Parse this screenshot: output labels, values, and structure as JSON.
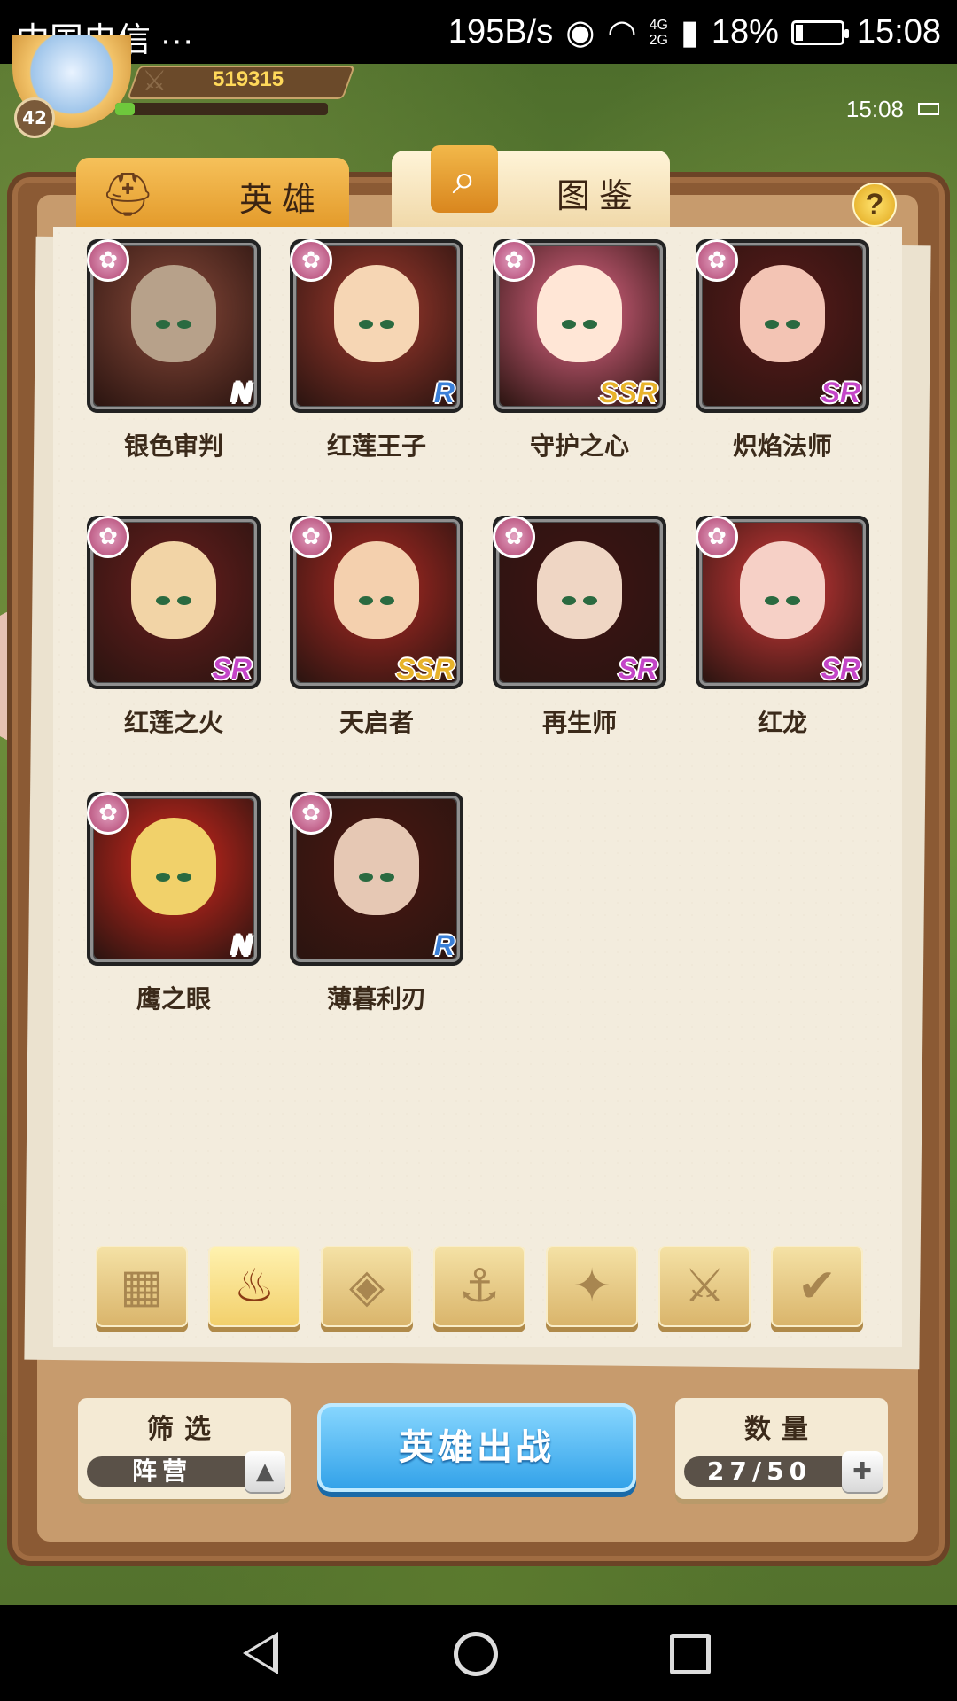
{
  "status_bar": {
    "carrier": "中国电信",
    "more": "···",
    "speed": "195B/s",
    "network_top": "4G",
    "network_bottom": "2G",
    "battery_percent": "18%",
    "time": "15:08"
  },
  "hud": {
    "player_level": "42",
    "power": "519315",
    "exp_fraction": 0.09,
    "game_time": "15:08"
  },
  "tabs": [
    {
      "label": "英雄",
      "icon": "knight-helmet-icon",
      "active": false
    },
    {
      "label": "图鉴",
      "icon": "magnifier-icon",
      "active": true
    }
  ],
  "help_label": "?",
  "heroes": [
    {
      "name": "银色审判",
      "rarity": "N",
      "rarity_color": "#ffffff",
      "faction_icon": "lotus-icon",
      "bg": "#8a4a3a",
      "face": "#b7a18a"
    },
    {
      "name": "红莲王子",
      "rarity": "R",
      "rarity_color": "#3a7fd8",
      "faction_icon": "lotus-icon",
      "bg": "#a23a2e",
      "face": "#f6d6b4"
    },
    {
      "name": "守护之心",
      "rarity": "SSR",
      "rarity_color": "#e8b32a",
      "faction_icon": "lotus-icon",
      "bg": "#e86a8a",
      "face": "#ffe6d6"
    },
    {
      "name": "炽焰法师",
      "rarity": "SR",
      "rarity_color": "#c445c8",
      "faction_icon": "lotus-icon",
      "bg": "#5a1a1a",
      "face": "#f3c4b4"
    },
    {
      "name": "红莲之火",
      "rarity": "SR",
      "rarity_color": "#c445c8",
      "faction_icon": "lotus-icon",
      "bg": "#6a1e1e",
      "face": "#f2d4a6"
    },
    {
      "name": "天启者",
      "rarity": "SSR",
      "rarity_color": "#e8b32a",
      "faction_icon": "lotus-icon",
      "bg": "#b02a24",
      "face": "#f4d0ae"
    },
    {
      "name": "再生师",
      "rarity": "SR",
      "rarity_color": "#c445c8",
      "faction_icon": "lotus-icon",
      "bg": "#3e1414",
      "face": "#efd6c4"
    },
    {
      "name": "红龙",
      "rarity": "SR",
      "rarity_color": "#c445c8",
      "faction_icon": "lotus-icon",
      "bg": "#d43a3a",
      "face": "#f6d0c6"
    },
    {
      "name": "鹰之眼",
      "rarity": "N",
      "rarity_color": "#ffffff",
      "faction_icon": "lotus-icon",
      "bg": "#d8281e",
      "face": "#f1d16a"
    },
    {
      "name": "薄暮利刃",
      "rarity": "R",
      "rarity_color": "#3a7fd8",
      "faction_icon": "lotus-icon",
      "bg": "#4a1812",
      "face": "#e6c8b4"
    }
  ],
  "faction_filters": [
    {
      "icon": "grid-all-icon",
      "glyph": "▦",
      "active": false
    },
    {
      "icon": "flame-faction-icon",
      "glyph": "♨",
      "active": true
    },
    {
      "icon": "diamond-faction-icon",
      "glyph": "◈",
      "active": false
    },
    {
      "icon": "anchor-faction-icon",
      "glyph": "⚓",
      "active": false
    },
    {
      "icon": "beast-faction-icon",
      "glyph": "✦",
      "active": false
    },
    {
      "icon": "fox-faction-icon",
      "glyph": "⚔",
      "active": false
    },
    {
      "icon": "wing-faction-icon",
      "glyph": "✔",
      "active": false
    }
  ],
  "filter_box": {
    "title": "筛选",
    "value": "阵营",
    "button_glyph": "▲"
  },
  "deploy_button": "英雄出战",
  "count_box": {
    "title": "数量",
    "value": "27/50",
    "button_glyph": "✚"
  }
}
